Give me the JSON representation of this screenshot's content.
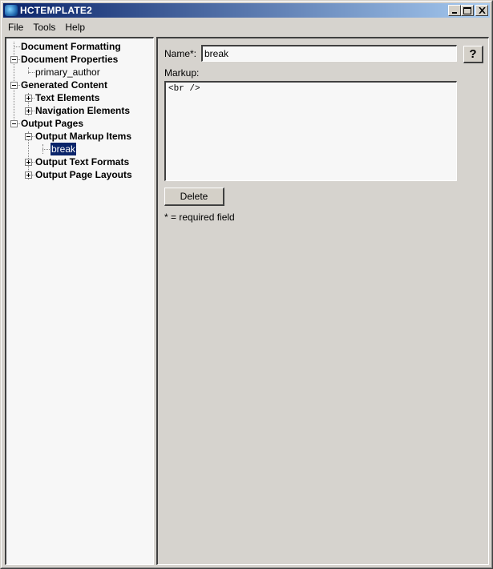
{
  "window": {
    "title": "HCTEMPLATE2",
    "app_icon": "globe-app-icon",
    "controls": {
      "minimize": "minimize-icon",
      "maximize": "maximize-icon",
      "close": "close-icon"
    }
  },
  "menubar": {
    "items": [
      {
        "label": "File"
      },
      {
        "label": "Tools"
      },
      {
        "label": "Help"
      }
    ]
  },
  "tree": {
    "nodes": [
      {
        "label": "Document Formatting",
        "level": 0,
        "expander": "none",
        "bold": true
      },
      {
        "label": "Document Properties",
        "level": 0,
        "expander": "minus",
        "bold": true
      },
      {
        "label": "primary_author",
        "level": 1,
        "expander": "none",
        "bold": false
      },
      {
        "label": "Generated Content",
        "level": 0,
        "expander": "minus",
        "bold": true
      },
      {
        "label": "Text Elements",
        "level": 1,
        "expander": "plus",
        "bold": true
      },
      {
        "label": "Navigation Elements",
        "level": 1,
        "expander": "plus",
        "bold": true
      },
      {
        "label": "Output Pages",
        "level": 0,
        "expander": "minus",
        "bold": true
      },
      {
        "label": "Output Markup Items",
        "level": 1,
        "expander": "minus",
        "bold": true
      },
      {
        "label": "break",
        "level": 2,
        "expander": "none",
        "bold": false,
        "selected": true
      },
      {
        "label": "Output Text Formats",
        "level": 1,
        "expander": "plus",
        "bold": true
      },
      {
        "label": "Output Page Layouts",
        "level": 1,
        "expander": "plus",
        "bold": true
      }
    ]
  },
  "form": {
    "name_label": "Name*:",
    "name_value": "break",
    "help_label": "?",
    "markup_label": "Markup:",
    "markup_value": "<br />",
    "delete_label": "Delete",
    "required_note": "* = required field"
  }
}
